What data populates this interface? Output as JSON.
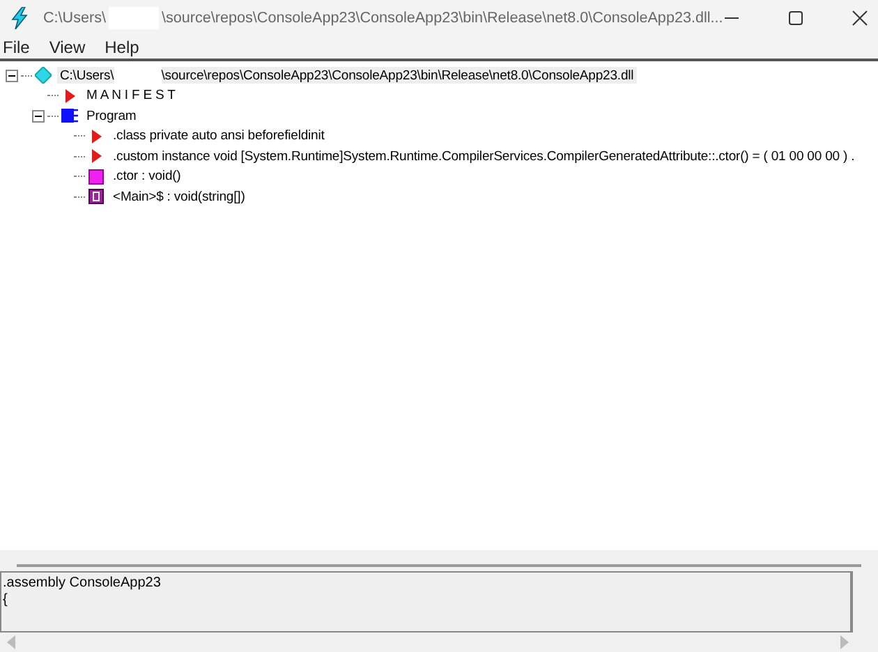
{
  "window": {
    "title_start": "C:\\Users\\",
    "title_end": "\\source\\repos\\ConsoleApp23\\ConsoleApp23\\bin\\Release\\net8.0\\ConsoleApp23.dll..."
  },
  "menu": [
    "File",
    "View",
    "Help"
  ],
  "tree": [
    {
      "kind": "assembly",
      "label": "C:\\Users\\",
      "label_rest": "\\source\\repos\\ConsoleApp23\\ConsoleApp23\\bin\\Release\\net8.0\\ConsoleApp23.dll",
      "expanded": true,
      "selected": true,
      "children": [
        {
          "kind": "manifest",
          "label": "M A N I F E S T",
          "selected": false
        },
        {
          "kind": "class",
          "label": "Program",
          "expanded": true,
          "selected": false,
          "children": [
            {
              "kind": "directive",
              "label": ".class private auto ansi beforefieldinit",
              "selected": false
            },
            {
              "kind": "directive",
              "label": ".custom instance void [System.Runtime]System.Runtime.CompilerServices.CompilerGeneratedAttribute::.ctor() = ( 01 00 00 00 ) .",
              "selected": false
            },
            {
              "kind": "method",
              "label": ".ctor : void()",
              "selected": false
            },
            {
              "kind": "static_method",
              "label": "<Main>$ : void(string[])",
              "selected": false
            }
          ]
        }
      ]
    }
  ],
  "detail": {
    "lines": [
      ".assembly ConsoleApp23",
      "{"
    ]
  }
}
